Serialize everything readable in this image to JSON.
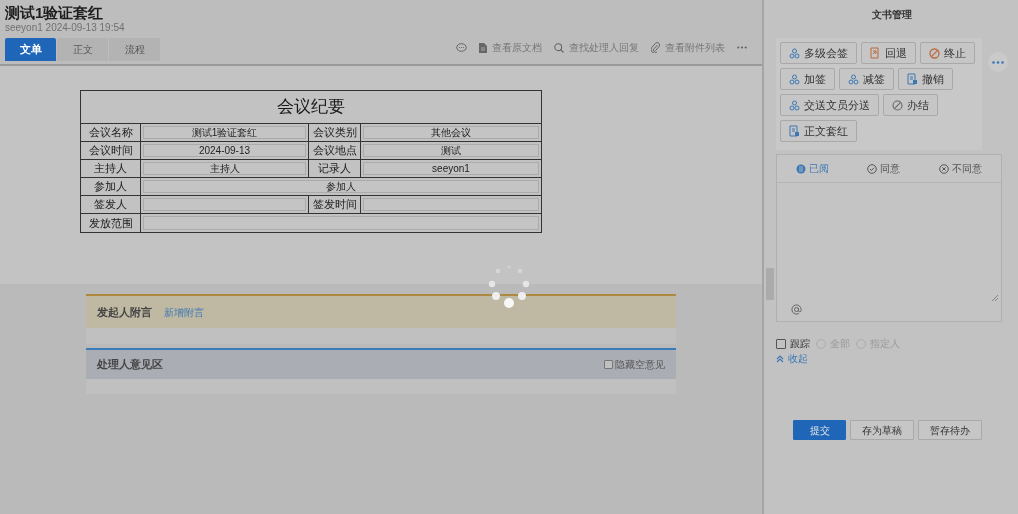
{
  "header": {
    "title": "测试1验证套红",
    "meta": "seeyon1 2024-09-13 19:54",
    "tabs": [
      {
        "label": "文单",
        "selected": true
      },
      {
        "label": "正文",
        "selected": false
      },
      {
        "label": "流程",
        "selected": false
      }
    ],
    "toolbar": [
      {
        "kind": "comment"
      },
      {
        "kind": "doc",
        "label": "查看原文档"
      },
      {
        "kind": "search",
        "label": "查找处理人回复"
      },
      {
        "kind": "clip",
        "label": "查看附件列表"
      },
      {
        "kind": "more"
      }
    ]
  },
  "form": {
    "title": "会议纪要",
    "fields": [
      {
        "kind": "half",
        "label": "会议名称",
        "value": "测试1验证套红"
      },
      {
        "kind": "half",
        "label": "会议类别",
        "value": "其他会议"
      },
      {
        "kind": "half",
        "label": "会议时间",
        "value": "2024-09-13"
      },
      {
        "kind": "half",
        "label": "会议地点",
        "value": "测试"
      },
      {
        "kind": "half",
        "label": "主持人",
        "value": "主持人"
      },
      {
        "kind": "half",
        "label": "记录人",
        "value": "seeyon1"
      },
      {
        "kind": "full",
        "label": "参加人",
        "value": "参加人"
      },
      {
        "kind": "half",
        "label": "签发人"
      },
      {
        "kind": "half",
        "label": "签发时间"
      },
      {
        "kind": "full",
        "label": "发放范围"
      }
    ]
  },
  "sender_note": {
    "title": "发起人附言",
    "link": "新增附言"
  },
  "opinions": {
    "title": "处理人意见区",
    "hide_empty": {
      "label": "隐藏空意见",
      "checked": false
    }
  },
  "panel": {
    "title": "文书管理",
    "actions": [
      {
        "kind": "people",
        "label": "多级会签"
      },
      {
        "kind": "return",
        "label": "回退"
      },
      {
        "kind": "forbid",
        "label": "终止"
      },
      {
        "kind": "people",
        "label": "加签"
      },
      {
        "kind": "people",
        "label": "减签"
      },
      {
        "kind": "doc",
        "label": "撤销"
      },
      {
        "kind": "people",
        "label": "交送文员分送"
      },
      {
        "kind": "finish",
        "label": "办结"
      },
      {
        "kind": "doc",
        "label": "正文套红"
      }
    ],
    "attitudes": [
      {
        "kind": "read",
        "label": "已阅",
        "selected": true
      },
      {
        "kind": "agree",
        "label": "同意",
        "selected": false
      },
      {
        "kind": "disagree",
        "label": "不同意",
        "selected": false
      }
    ],
    "track": {
      "label": "跟踪",
      "checked": false
    },
    "track_options": [
      {
        "label": "全部",
        "selected": false,
        "disabled": true
      },
      {
        "label": "指定人",
        "selected": false,
        "disabled": true
      }
    ],
    "collapse": "收起",
    "buttons": [
      {
        "kind": "primary",
        "label": "提交"
      },
      {
        "kind": "plain",
        "label": "存为草稿"
      },
      {
        "kind": "plain",
        "label": "暂存待办"
      }
    ]
  }
}
